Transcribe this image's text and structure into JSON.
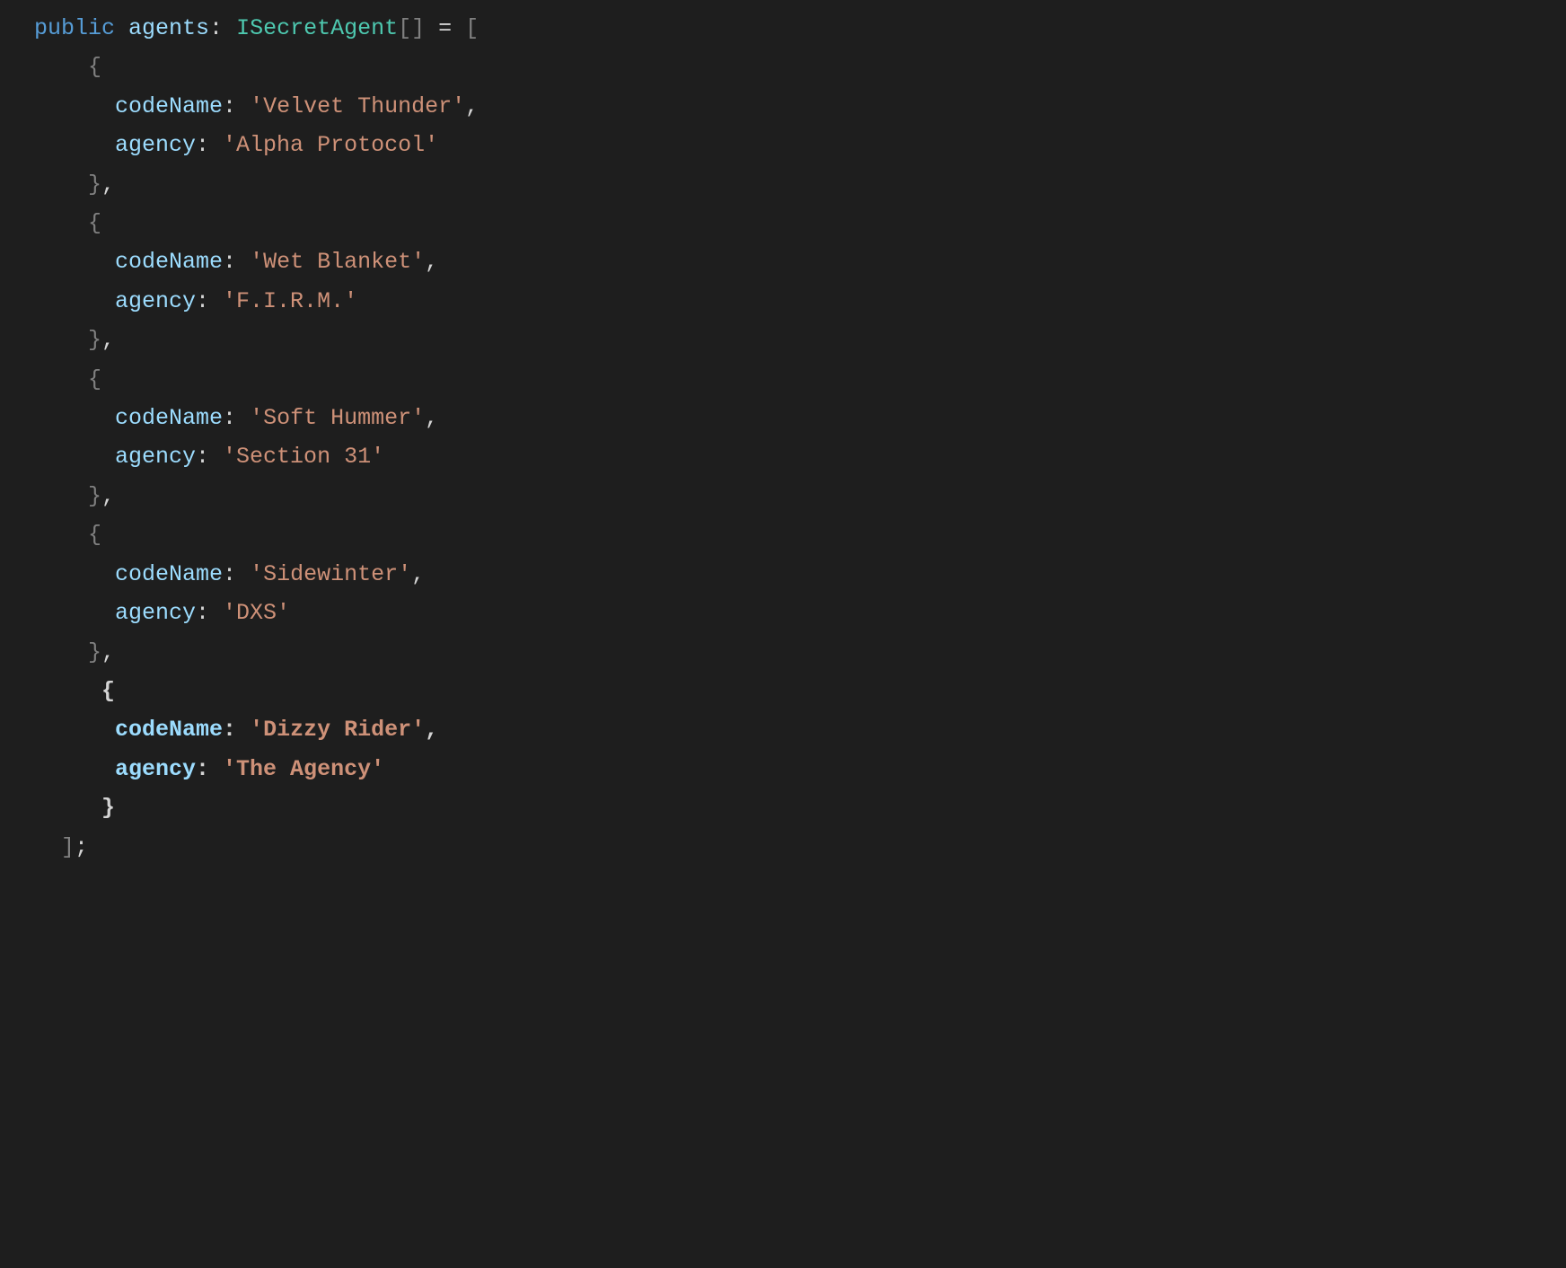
{
  "tokens": {
    "public": "public",
    "agents": "agents",
    "type": "ISecretAgent",
    "codeName": "codeName",
    "agency": "agency"
  },
  "entries": [
    {
      "codeName": "'Velvet Thunder'",
      "agency": "'Alpha Protocol'"
    },
    {
      "codeName": "'Wet Blanket'",
      "agency": "'F.I.R.M.'"
    },
    {
      "codeName": "'Soft Hummer'",
      "agency": "'Section 31'"
    },
    {
      "codeName": "'Sidewinter'",
      "agency": "'DXS'"
    },
    {
      "codeName": "'Dizzy Rider'",
      "agency": "'The Agency'"
    }
  ]
}
